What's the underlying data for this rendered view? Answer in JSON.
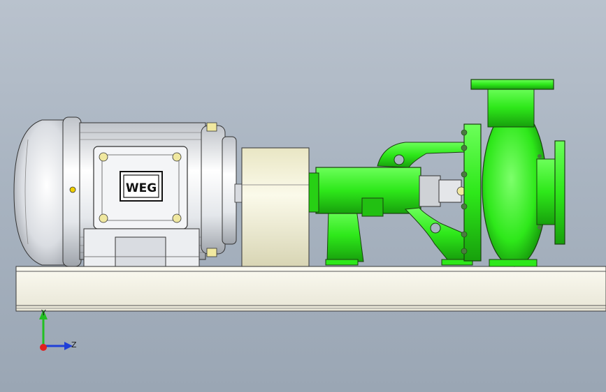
{
  "viewport": {
    "background_top": "#b9c2cd",
    "background_bottom": "#9aa6b4"
  },
  "model": {
    "motor_logo": "WEG",
    "pump_color": "#2ee81a",
    "pump_shadow": "#17a00c",
    "motor_color": "#e6e8ec",
    "coupling_guard_color": "#f4f2d6",
    "baseplate_color": "#f3f1e4"
  },
  "triad": {
    "x_axis_label": "",
    "y_axis_label": "Y",
    "z_axis_label": "Z",
    "y_color": "#22c022",
    "z_color": "#1f3fd8",
    "x_color": "#e02020",
    "icon": "coordinate-triad-icon"
  }
}
